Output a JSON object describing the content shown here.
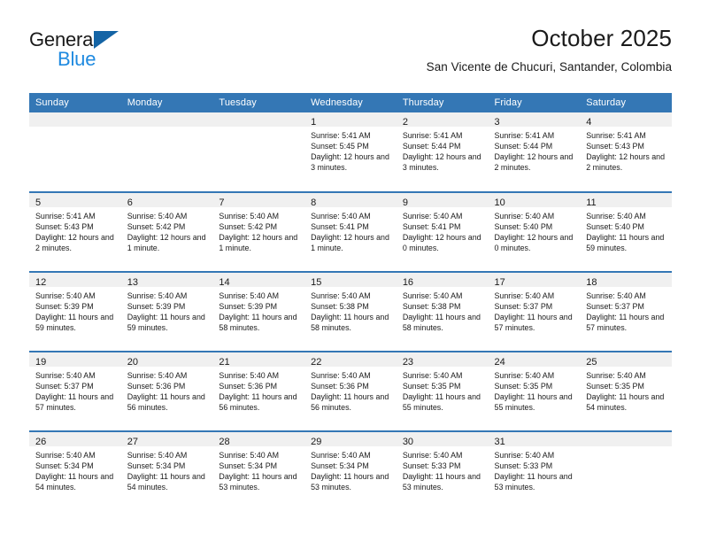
{
  "brand": {
    "name_top": "General",
    "name_bottom": "Blue",
    "accent_color": "#1464a5",
    "blue_text_color": "#1f8ae0"
  },
  "header": {
    "title": "October 2025",
    "subtitle": "San Vicente de Chucuri, Santander, Colombia"
  },
  "theme": {
    "header_row_bg": "#3477b5",
    "header_row_text": "#ffffff",
    "daynum_band_bg": "#f0f0f0",
    "cell_bg": "#ffffff",
    "row_divider": "#3477b5"
  },
  "weekday_headers": [
    "Sunday",
    "Monday",
    "Tuesday",
    "Wednesday",
    "Thursday",
    "Friday",
    "Saturday"
  ],
  "weeks": [
    [
      {
        "empty": true
      },
      {
        "empty": true
      },
      {
        "empty": true
      },
      {
        "day": "1",
        "sunrise": "Sunrise: 5:41 AM",
        "sunset": "Sunset: 5:45 PM",
        "daylight": "Daylight: 12 hours and 3 minutes."
      },
      {
        "day": "2",
        "sunrise": "Sunrise: 5:41 AM",
        "sunset": "Sunset: 5:44 PM",
        "daylight": "Daylight: 12 hours and 3 minutes."
      },
      {
        "day": "3",
        "sunrise": "Sunrise: 5:41 AM",
        "sunset": "Sunset: 5:44 PM",
        "daylight": "Daylight: 12 hours and 2 minutes."
      },
      {
        "day": "4",
        "sunrise": "Sunrise: 5:41 AM",
        "sunset": "Sunset: 5:43 PM",
        "daylight": "Daylight: 12 hours and 2 minutes."
      }
    ],
    [
      {
        "day": "5",
        "sunrise": "Sunrise: 5:41 AM",
        "sunset": "Sunset: 5:43 PM",
        "daylight": "Daylight: 12 hours and 2 minutes."
      },
      {
        "day": "6",
        "sunrise": "Sunrise: 5:40 AM",
        "sunset": "Sunset: 5:42 PM",
        "daylight": "Daylight: 12 hours and 1 minute."
      },
      {
        "day": "7",
        "sunrise": "Sunrise: 5:40 AM",
        "sunset": "Sunset: 5:42 PM",
        "daylight": "Daylight: 12 hours and 1 minute."
      },
      {
        "day": "8",
        "sunrise": "Sunrise: 5:40 AM",
        "sunset": "Sunset: 5:41 PM",
        "daylight": "Daylight: 12 hours and 1 minute."
      },
      {
        "day": "9",
        "sunrise": "Sunrise: 5:40 AM",
        "sunset": "Sunset: 5:41 PM",
        "daylight": "Daylight: 12 hours and 0 minutes."
      },
      {
        "day": "10",
        "sunrise": "Sunrise: 5:40 AM",
        "sunset": "Sunset: 5:40 PM",
        "daylight": "Daylight: 12 hours and 0 minutes."
      },
      {
        "day": "11",
        "sunrise": "Sunrise: 5:40 AM",
        "sunset": "Sunset: 5:40 PM",
        "daylight": "Daylight: 11 hours and 59 minutes."
      }
    ],
    [
      {
        "day": "12",
        "sunrise": "Sunrise: 5:40 AM",
        "sunset": "Sunset: 5:39 PM",
        "daylight": "Daylight: 11 hours and 59 minutes."
      },
      {
        "day": "13",
        "sunrise": "Sunrise: 5:40 AM",
        "sunset": "Sunset: 5:39 PM",
        "daylight": "Daylight: 11 hours and 59 minutes."
      },
      {
        "day": "14",
        "sunrise": "Sunrise: 5:40 AM",
        "sunset": "Sunset: 5:39 PM",
        "daylight": "Daylight: 11 hours and 58 minutes."
      },
      {
        "day": "15",
        "sunrise": "Sunrise: 5:40 AM",
        "sunset": "Sunset: 5:38 PM",
        "daylight": "Daylight: 11 hours and 58 minutes."
      },
      {
        "day": "16",
        "sunrise": "Sunrise: 5:40 AM",
        "sunset": "Sunset: 5:38 PM",
        "daylight": "Daylight: 11 hours and 58 minutes."
      },
      {
        "day": "17",
        "sunrise": "Sunrise: 5:40 AM",
        "sunset": "Sunset: 5:37 PM",
        "daylight": "Daylight: 11 hours and 57 minutes."
      },
      {
        "day": "18",
        "sunrise": "Sunrise: 5:40 AM",
        "sunset": "Sunset: 5:37 PM",
        "daylight": "Daylight: 11 hours and 57 minutes."
      }
    ],
    [
      {
        "day": "19",
        "sunrise": "Sunrise: 5:40 AM",
        "sunset": "Sunset: 5:37 PM",
        "daylight": "Daylight: 11 hours and 57 minutes."
      },
      {
        "day": "20",
        "sunrise": "Sunrise: 5:40 AM",
        "sunset": "Sunset: 5:36 PM",
        "daylight": "Daylight: 11 hours and 56 minutes."
      },
      {
        "day": "21",
        "sunrise": "Sunrise: 5:40 AM",
        "sunset": "Sunset: 5:36 PM",
        "daylight": "Daylight: 11 hours and 56 minutes."
      },
      {
        "day": "22",
        "sunrise": "Sunrise: 5:40 AM",
        "sunset": "Sunset: 5:36 PM",
        "daylight": "Daylight: 11 hours and 56 minutes."
      },
      {
        "day": "23",
        "sunrise": "Sunrise: 5:40 AM",
        "sunset": "Sunset: 5:35 PM",
        "daylight": "Daylight: 11 hours and 55 minutes."
      },
      {
        "day": "24",
        "sunrise": "Sunrise: 5:40 AM",
        "sunset": "Sunset: 5:35 PM",
        "daylight": "Daylight: 11 hours and 55 minutes."
      },
      {
        "day": "25",
        "sunrise": "Sunrise: 5:40 AM",
        "sunset": "Sunset: 5:35 PM",
        "daylight": "Daylight: 11 hours and 54 minutes."
      }
    ],
    [
      {
        "day": "26",
        "sunrise": "Sunrise: 5:40 AM",
        "sunset": "Sunset: 5:34 PM",
        "daylight": "Daylight: 11 hours and 54 minutes."
      },
      {
        "day": "27",
        "sunrise": "Sunrise: 5:40 AM",
        "sunset": "Sunset: 5:34 PM",
        "daylight": "Daylight: 11 hours and 54 minutes."
      },
      {
        "day": "28",
        "sunrise": "Sunrise: 5:40 AM",
        "sunset": "Sunset: 5:34 PM",
        "daylight": "Daylight: 11 hours and 53 minutes."
      },
      {
        "day": "29",
        "sunrise": "Sunrise: 5:40 AM",
        "sunset": "Sunset: 5:34 PM",
        "daylight": "Daylight: 11 hours and 53 minutes."
      },
      {
        "day": "30",
        "sunrise": "Sunrise: 5:40 AM",
        "sunset": "Sunset: 5:33 PM",
        "daylight": "Daylight: 11 hours and 53 minutes."
      },
      {
        "day": "31",
        "sunrise": "Sunrise: 5:40 AM",
        "sunset": "Sunset: 5:33 PM",
        "daylight": "Daylight: 11 hours and 53 minutes."
      },
      {
        "empty": true
      }
    ]
  ]
}
